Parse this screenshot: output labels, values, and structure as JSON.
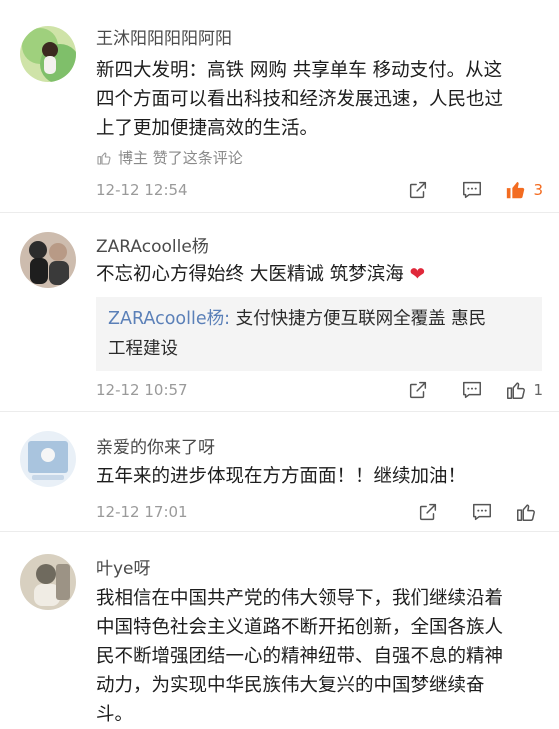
{
  "comments": [
    {
      "user": "王沐阳阳阳阳阿阳",
      "text_lines": [
        "新四大发明：高铁 网购 共享单车 移动支付。从这",
        "四个方面可以看出科技和经济发展迅速，人民也过",
        "上了更加便捷高效的生活。"
      ],
      "liked_note": "博主 赞了这条评论",
      "time": "12-12 12:54",
      "likes": "3",
      "liked_by_me": true,
      "avatar_colors": [
        "#7fbf6a",
        "#cfe3a8"
      ]
    },
    {
      "user": "ZARAcoolle杨",
      "text": "不忘初心方得始终 大医精诚 筑梦滨海",
      "emoji": "❤",
      "reply_user": "ZARAcoolle杨",
      "reply_sep": ":",
      "reply_lines": [
        " 支付快捷方便互联网全覆盖 惠民",
        "工程建设"
      ],
      "time": "12-12 10:57",
      "likes": "1",
      "liked_by_me": false,
      "avatar_colors": [
        "#3a3a3a",
        "#b89a86"
      ]
    },
    {
      "user": "亲爱的你来了呀",
      "text": "五年来的进步体现在方方面面！！继续加油！",
      "time": "12-12 17:01",
      "likes": "",
      "liked_by_me": false,
      "avatar_colors": [
        "#a9c4de",
        "#e9f0f7"
      ]
    },
    {
      "user": "叶ye呀",
      "text_lines": [
        "我相信在中国共产党的伟大领导下，我们继续沿着",
        "中国特色社会主义道路不断开拓创新，全国各族人",
        "民不断增强团结一心的精神纽带、自强不息的精神",
        "动力，为实现中华民族伟大复兴的中国梦继续奋",
        "斗。"
      ],
      "avatar_colors": [
        "#6f6a5e",
        "#d8d0c0"
      ]
    }
  ],
  "colors": {
    "accent": "#f36c21",
    "link": "#5b80b8",
    "heart": "#e0283a"
  }
}
